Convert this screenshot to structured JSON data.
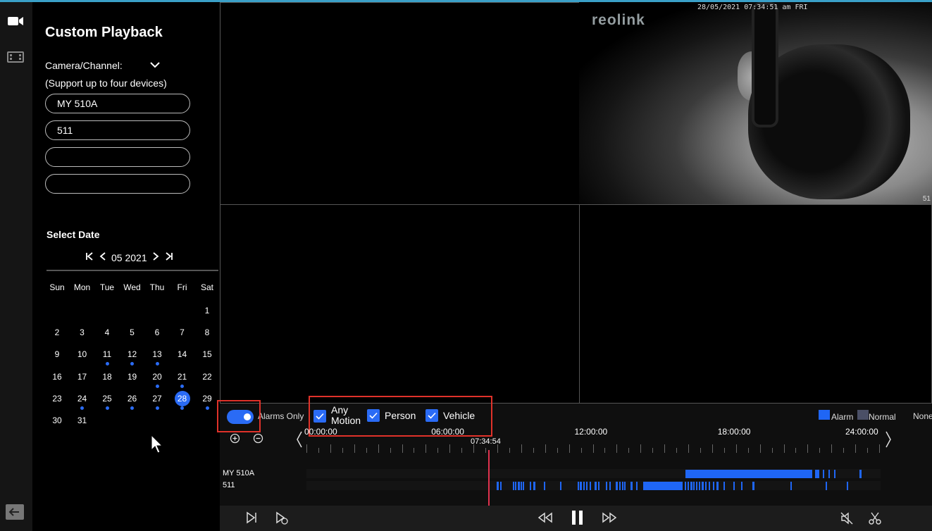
{
  "sidebar": {
    "title": "Custom Playback"
  },
  "channels": {
    "label": "Camera/Channel:",
    "hint": "(Support up to four devices)",
    "slots": [
      "MY 510A",
      "511",
      "",
      ""
    ]
  },
  "calendar": {
    "label": "Select Date",
    "month_year": "05 2021",
    "weekdays": [
      "Sun",
      "Mon",
      "Tue",
      "Wed",
      "Thu",
      "Fri",
      "Sat"
    ],
    "days": [
      "1",
      "2",
      "3",
      "4",
      "5",
      "6",
      "7",
      "8",
      "9",
      "10",
      "11",
      "12",
      "13",
      "14",
      "15",
      "16",
      "17",
      "18",
      "19",
      "20",
      "21",
      "22",
      "23",
      "24",
      "25",
      "26",
      "27",
      "28",
      "29",
      "30",
      "31"
    ],
    "selected_day": "28",
    "recorded_days": [
      "11",
      "12",
      "13",
      "20",
      "21",
      "24",
      "25",
      "26",
      "27",
      "28",
      "29"
    ],
    "accent": "#2a6bf5"
  },
  "camera": {
    "logo": "reolink",
    "timestamp": "28/05/2021 07:34:51 am FRI",
    "channel_number": "51"
  },
  "filters": {
    "alarms_only": {
      "label": "Alarms Only",
      "on": true
    },
    "any_motion_1": "Any",
    "any_motion_2": "Motion",
    "person": "Person",
    "vehicle": "Vehicle"
  },
  "legend": {
    "alarm": "Alarm",
    "normal": "Normal",
    "none": "None",
    "alarm_color": "#1f66f5",
    "normal_color": "#4a4f66"
  },
  "timeline": {
    "labels": [
      "00:00:00",
      "06:00:00",
      "12:00:00",
      "18:00:00",
      "24:00:00"
    ],
    "cursor": "07:34:54",
    "rows": [
      "MY 510A",
      "511"
    ]
  }
}
